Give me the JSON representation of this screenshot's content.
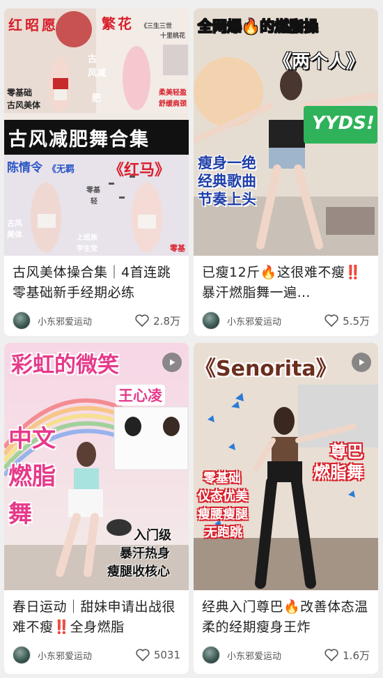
{
  "feed": {
    "cards": [
      {
        "title": "古风美体操合集｜4首连跳零基础新手经期必练",
        "author": "小东邪爱运动",
        "likes": "2.8万",
        "thumb_text": {
          "top_left": "红昭愿",
          "top_mid": "繁花",
          "top_small": "《三生三世",
          "top_small2": "十里桃花",
          "side1": "零基础",
          "side2": "古风美体",
          "side3": "古",
          "side4": "风减",
          "side5": "肥",
          "side6": "柔美轻盈",
          "side7": "舒缓肩颈",
          "banner": "古风减肥舞合集",
          "mid_left": "陈情令",
          "mid_small": "《无羁",
          "mid_right": "《红马》",
          "low_left": "古风",
          "low_left2": "美体",
          "low_mid": "零基",
          "low_mid2": "轻",
          "low_mid3": "上班族",
          "low_mid4": "学生党",
          "low_right": "零基"
        }
      },
      {
        "title": "已瘦12斤🔥这很难不瘦‼️暴汗燃脂舞一遍…",
        "author": "小东邪爱运动",
        "likes": "5.5万",
        "thumb_text": {
          "top": "全网爆🔥的燃脂操",
          "sub": "《两个人》",
          "badge": "YYDS!",
          "left1": "瘦身一绝",
          "left2": "经典歌曲",
          "left3": "节奏上头"
        }
      },
      {
        "title": "春日运动｜甜妹申请出战很难不瘦‼️全身燃脂",
        "author": "小东邪爱运动",
        "likes": "5031",
        "thumb_text": {
          "top": "彩虹的微笑",
          "name": "王心凌",
          "v1": "中文",
          "v2": "燃脂",
          "v3": "舞",
          "r1": "入门级",
          "r2": "暴汗热身",
          "r3": "瘦腿收核心"
        }
      },
      {
        "title": "经典入门尊巴🔥改善体态温柔的经期瘦身王炸",
        "author": "小东邪爱运动",
        "likes": "1.6万",
        "thumb_text": {
          "top": "《Senorita》",
          "r1": "尊巴",
          "r2": "燃脂舞",
          "l1": "零基础",
          "l2": "仪态优美",
          "l3": "瘦腰瘦腿",
          "l4": "无跑跳"
        }
      }
    ]
  },
  "colors": {
    "accent_red": "#d81e2a",
    "brown_text": "#6b2e1f",
    "pink_bg": "#f6d8e2",
    "green_badge": "#2fb25a"
  },
  "icons": {
    "like": "heart-outline-icon",
    "play": "play-icon",
    "avatar": "avatar"
  }
}
